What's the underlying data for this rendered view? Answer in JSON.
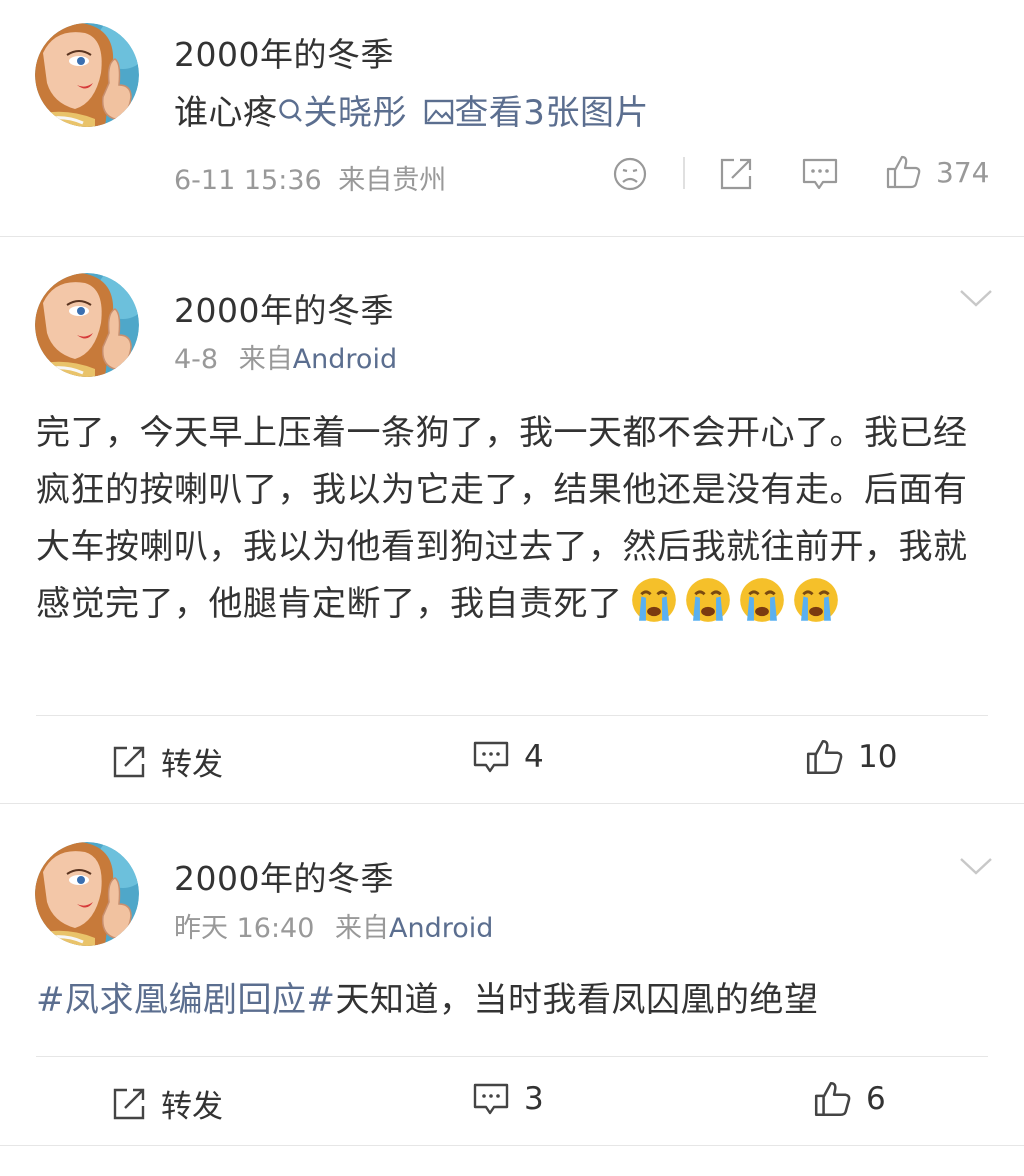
{
  "top_post": {
    "username": "2000年的冬季",
    "text_prefix": "谁心疼",
    "mention": "关晓彤",
    "images_link": "查看3张图片",
    "timestamp": "6-11 15:36",
    "source_label": "来自贵州",
    "like_count": "374"
  },
  "comments": [
    {
      "username": "2000年的冬季",
      "timestamp": "4-8",
      "source_prefix": "来自",
      "source": "Android",
      "body": "完了，今天早上压着一条狗了，我一天都不会开心了。我已经疯狂的按喇叭了，我以为它走了，结果他还是没有走。后面有大车按喇叭，我以为他看到狗过去了，然后我就往前开，我就感觉完了，他腿肯定断了，我自责死了",
      "emojis": [
        "crying-face",
        "crying-face",
        "crying-face",
        "crying-face"
      ],
      "repost_label": "转发",
      "comment_count": "4",
      "like_count": "10"
    },
    {
      "username": "2000年的冬季",
      "timestamp": "昨天 16:40",
      "source_prefix": "来自",
      "source": "Android",
      "hashtag": "#凤求凰编剧回应#",
      "body": "天知道，当时我看凤囚凰的绝望",
      "repost_label": "转发",
      "comment_count": "3",
      "like_count": "6"
    }
  ],
  "colors": {
    "text": "#333333",
    "meta": "#999999",
    "link": "#5b6e8f",
    "divider": "#e6e6e6",
    "emoji": "#f5c02a",
    "tears": "#5ab0f0"
  }
}
